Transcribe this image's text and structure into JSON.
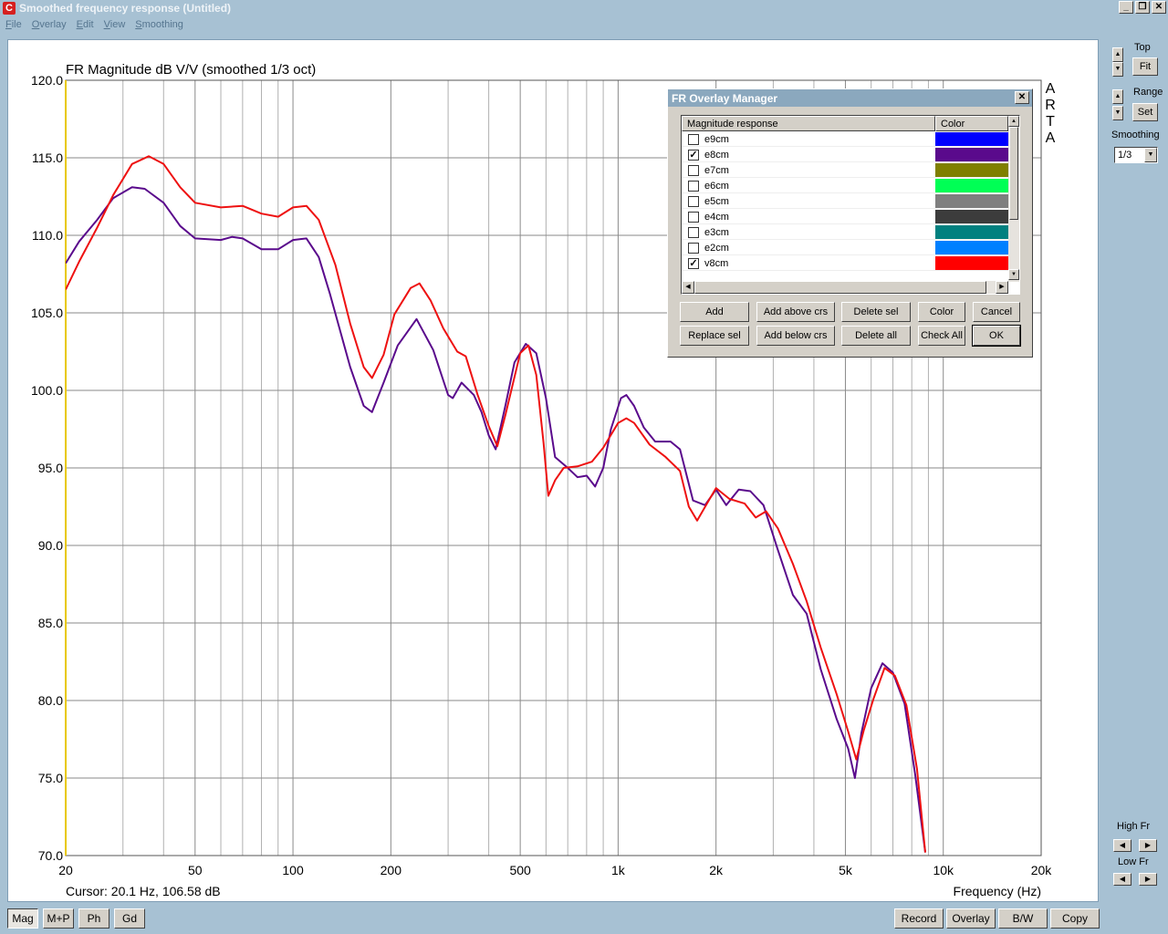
{
  "window": {
    "title": "Smoothed frequency response (Untitled)",
    "icon": "C"
  },
  "menu": [
    "File",
    "Overlay",
    "Edit",
    "View",
    "Smoothing"
  ],
  "side": {
    "top_label": "Top",
    "fit_label": "Fit",
    "range_label": "Range",
    "set_label": "Set",
    "smoothing_label": "Smoothing",
    "smoothing_value": "1/3",
    "high_fr_label": "High Fr",
    "low_fr_label": "Low Fr"
  },
  "bottom_left": [
    "Mag",
    "M+P",
    "Ph",
    "Gd"
  ],
  "bottom_right": [
    "Record",
    "Overlay",
    "B/W",
    "Copy"
  ],
  "plot": {
    "cursor_text": "Cursor: 20.1 Hz, 106.58 dB",
    "arta_letters": [
      "A",
      "R",
      "T",
      "A"
    ]
  },
  "chart_data": {
    "type": "line",
    "title": "FR Magnitude dB V/V (smoothed 1/3 oct)",
    "xlabel": "Frequency (Hz)",
    "ylabel": "",
    "x_scale": "log",
    "xlim": [
      20,
      20000
    ],
    "ylim": [
      70,
      120
    ],
    "x_ticks": [
      {
        "v": 20,
        "label": "20"
      },
      {
        "v": 50,
        "label": "50"
      },
      {
        "v": 100,
        "label": "100"
      },
      {
        "v": 200,
        "label": "200"
      },
      {
        "v": 500,
        "label": "500"
      },
      {
        "v": 1000,
        "label": "1k"
      },
      {
        "v": 2000,
        "label": "2k"
      },
      {
        "v": 5000,
        "label": "5k"
      },
      {
        "v": 10000,
        "label": "10k"
      },
      {
        "v": 20000,
        "label": "20k"
      }
    ],
    "y_ticks": [
      "120.0",
      "115.0",
      "110.0",
      "105.0",
      "100.0",
      "95.0",
      "90.0",
      "85.0",
      "80.0",
      "75.0",
      "70.0"
    ],
    "grid": true,
    "series": [
      {
        "name": "e8cm",
        "color": "#5a0a8c",
        "points": [
          [
            20,
            108.2
          ],
          [
            22,
            109.6
          ],
          [
            25,
            111.0
          ],
          [
            28,
            112.4
          ],
          [
            32,
            113.1
          ],
          [
            35,
            113.0
          ],
          [
            40,
            112.1
          ],
          [
            45,
            110.6
          ],
          [
            50,
            109.8
          ],
          [
            60,
            109.7
          ],
          [
            65,
            109.9
          ],
          [
            70,
            109.8
          ],
          [
            80,
            109.1
          ],
          [
            90,
            109.1
          ],
          [
            100,
            109.7
          ],
          [
            110,
            109.8
          ],
          [
            120,
            108.6
          ],
          [
            130,
            106.2
          ],
          [
            150,
            101.5
          ],
          [
            165,
            99.0
          ],
          [
            175,
            98.6
          ],
          [
            190,
            100.5
          ],
          [
            210,
            102.9
          ],
          [
            240,
            104.6
          ],
          [
            270,
            102.6
          ],
          [
            300,
            99.7
          ],
          [
            310,
            99.5
          ],
          [
            330,
            100.5
          ],
          [
            360,
            99.7
          ],
          [
            380,
            98.6
          ],
          [
            400,
            97.1
          ],
          [
            420,
            96.2
          ],
          [
            450,
            99.0
          ],
          [
            480,
            101.8
          ],
          [
            520,
            103.0
          ],
          [
            560,
            102.4
          ],
          [
            600,
            99.5
          ],
          [
            640,
            95.7
          ],
          [
            700,
            95.0
          ],
          [
            750,
            94.4
          ],
          [
            800,
            94.5
          ],
          [
            850,
            93.8
          ],
          [
            900,
            95.0
          ],
          [
            950,
            97.5
          ],
          [
            1020,
            99.5
          ],
          [
            1060,
            99.7
          ],
          [
            1120,
            99.0
          ],
          [
            1200,
            97.6
          ],
          [
            1300,
            96.7
          ],
          [
            1450,
            96.7
          ],
          [
            1550,
            96.2
          ],
          [
            1700,
            92.9
          ],
          [
            1850,
            92.6
          ],
          [
            2000,
            93.6
          ],
          [
            2150,
            92.6
          ],
          [
            2350,
            93.6
          ],
          [
            2550,
            93.5
          ],
          [
            2800,
            92.6
          ],
          [
            3100,
            89.7
          ],
          [
            3450,
            86.8
          ],
          [
            3800,
            85.6
          ],
          [
            4200,
            82.0
          ],
          [
            4700,
            78.8
          ],
          [
            5100,
            76.9
          ],
          [
            5350,
            75.0
          ],
          [
            5600,
            77.9
          ],
          [
            6000,
            80.8
          ],
          [
            6500,
            82.4
          ],
          [
            7000,
            81.8
          ],
          [
            7600,
            79.8
          ],
          [
            8200,
            75.2
          ],
          [
            8800,
            70.2
          ]
        ]
      },
      {
        "name": "v8cm",
        "color": "#ee1111",
        "points": [
          [
            20,
            106.5
          ],
          [
            22,
            108.3
          ],
          [
            25,
            110.5
          ],
          [
            28,
            112.6
          ],
          [
            32,
            114.6
          ],
          [
            36,
            115.1
          ],
          [
            40,
            114.6
          ],
          [
            45,
            113.1
          ],
          [
            50,
            112.1
          ],
          [
            60,
            111.8
          ],
          [
            70,
            111.9
          ],
          [
            80,
            111.4
          ],
          [
            90,
            111.2
          ],
          [
            100,
            111.8
          ],
          [
            110,
            111.9
          ],
          [
            120,
            111.0
          ],
          [
            135,
            108.1
          ],
          [
            150,
            104.3
          ],
          [
            165,
            101.5
          ],
          [
            175,
            100.8
          ],
          [
            190,
            102.3
          ],
          [
            205,
            104.9
          ],
          [
            230,
            106.6
          ],
          [
            245,
            106.9
          ],
          [
            265,
            105.8
          ],
          [
            290,
            104.0
          ],
          [
            320,
            102.5
          ],
          [
            340,
            102.2
          ],
          [
            370,
            99.7
          ],
          [
            400,
            97.7
          ],
          [
            425,
            96.4
          ],
          [
            450,
            98.4
          ],
          [
            500,
            102.4
          ],
          [
            530,
            102.9
          ],
          [
            560,
            101.0
          ],
          [
            590,
            96.6
          ],
          [
            610,
            93.2
          ],
          [
            640,
            94.2
          ],
          [
            680,
            95.0
          ],
          [
            750,
            95.1
          ],
          [
            830,
            95.4
          ],
          [
            900,
            96.3
          ],
          [
            1000,
            97.9
          ],
          [
            1060,
            98.2
          ],
          [
            1120,
            97.9
          ],
          [
            1250,
            96.5
          ],
          [
            1400,
            95.7
          ],
          [
            1550,
            94.8
          ],
          [
            1650,
            92.5
          ],
          [
            1750,
            91.6
          ],
          [
            1900,
            92.9
          ],
          [
            2000,
            93.7
          ],
          [
            2200,
            93.0
          ],
          [
            2450,
            92.7
          ],
          [
            2650,
            91.8
          ],
          [
            2850,
            92.2
          ],
          [
            3100,
            91.1
          ],
          [
            3450,
            88.8
          ],
          [
            3800,
            86.4
          ],
          [
            4200,
            83.4
          ],
          [
            4700,
            80.4
          ],
          [
            5100,
            78.0
          ],
          [
            5400,
            76.2
          ],
          [
            5700,
            78.1
          ],
          [
            6100,
            80.1
          ],
          [
            6600,
            82.1
          ],
          [
            7100,
            81.6
          ],
          [
            7700,
            79.7
          ],
          [
            8300,
            75.6
          ],
          [
            8800,
            70.2
          ]
        ]
      }
    ]
  },
  "dialog": {
    "title": "FR Overlay Manager",
    "col_name": "Magnitude response",
    "col_color": "Color",
    "rows": [
      {
        "name": "e9cm",
        "checked": false,
        "color": "#0000ff"
      },
      {
        "name": "e8cm",
        "checked": true,
        "color": "#5a0a8c"
      },
      {
        "name": "e7cm",
        "checked": false,
        "color": "#7f7f00"
      },
      {
        "name": "e6cm",
        "checked": false,
        "color": "#00ff55"
      },
      {
        "name": "e5cm",
        "checked": false,
        "color": "#7f7f7f"
      },
      {
        "name": "e4cm",
        "checked": false,
        "color": "#3c3c3c"
      },
      {
        "name": "e3cm",
        "checked": false,
        "color": "#00807f"
      },
      {
        "name": "e2cm",
        "checked": false,
        "color": "#0080ff"
      },
      {
        "name": "v8cm",
        "checked": true,
        "color": "#ff0000"
      }
    ],
    "buttons_row1": [
      "Add",
      "Add above crs",
      "Delete sel",
      "Color",
      "Cancel"
    ],
    "buttons_row2": [
      "Replace sel",
      "Add below crs",
      "Delete all",
      "Check All",
      "OK"
    ]
  }
}
